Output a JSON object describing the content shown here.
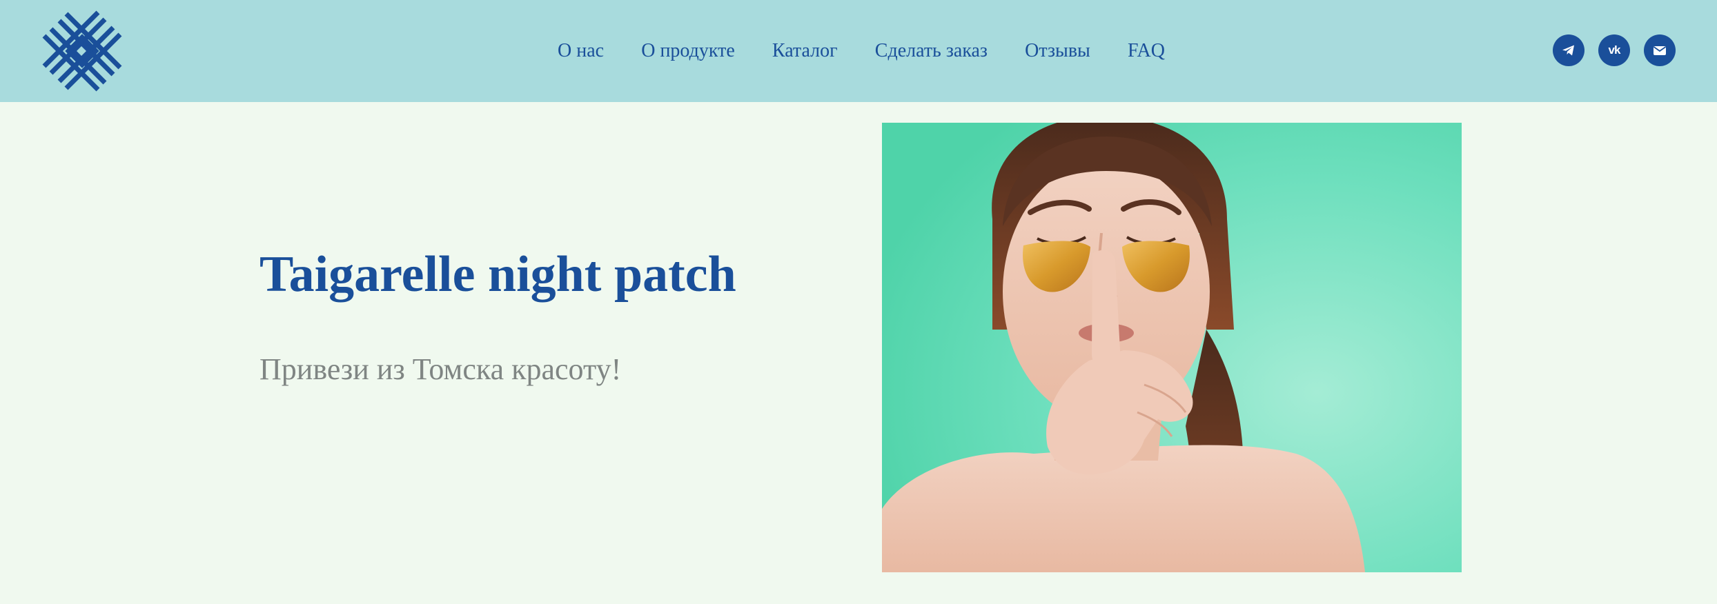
{
  "header": {
    "logo": {
      "icon": "ornament-logo-icon",
      "color": "#1a4f9a"
    },
    "nav": [
      {
        "label": "О нас"
      },
      {
        "label": "О продукте"
      },
      {
        "label": "Каталог"
      },
      {
        "label": "Сделать заказ"
      },
      {
        "label": "Отзывы"
      },
      {
        "label": "FAQ"
      }
    ],
    "socials": [
      {
        "icon": "telegram-icon"
      },
      {
        "icon": "vk-icon",
        "glyph": "vk"
      },
      {
        "icon": "mail-icon"
      }
    ]
  },
  "hero": {
    "title": "Taigarelle night patch",
    "subtitle": "Привези из Томска красоту!",
    "image": {
      "description_icon": "woman-with-eye-patches-image"
    }
  },
  "colors": {
    "header_bg": "#a8dbdd",
    "page_bg": "#f0f9ef",
    "accent": "#1a4f9a",
    "subtitle": "#7f8583",
    "photo_bg": "#5fd9b4"
  }
}
